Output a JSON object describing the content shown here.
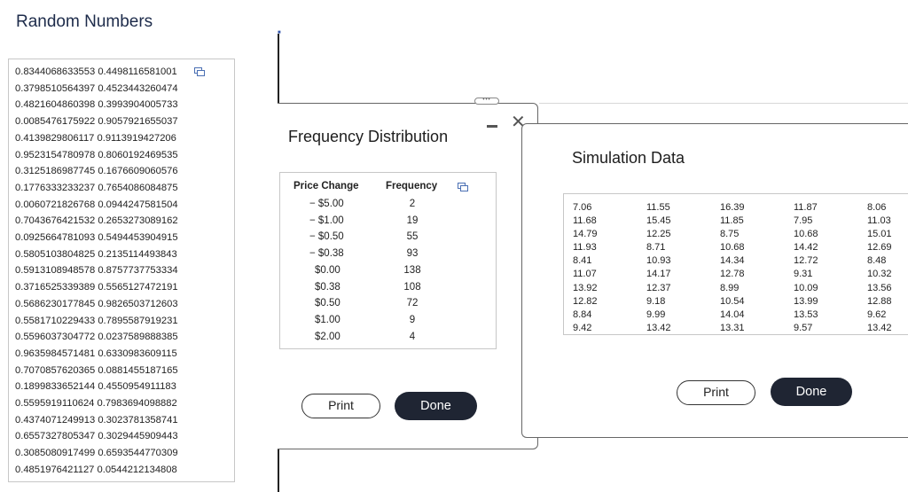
{
  "main_title": "Random Numbers",
  "random_numbers": [
    "0.8344068633553 0.4498116581001",
    "0.3798510564397 0.4523443260474",
    "0.4821604860398 0.3993904005733",
    "0.0085476175922 0.9057921655037",
    "0.4139829806117 0.9113919427206",
    "0.9523154780978 0.8060192469535",
    "0.3125186987745 0.1676609060576",
    "0.1776333233237 0.7654086084875",
    "0.0060721826768 0.0944247581504",
    "0.7043676421532 0.2653273089162",
    "0.0925664781093 0.5494453904915",
    "0.5805103804825 0.2135114493843",
    "0.5913108948578 0.8757737753334",
    "0.3716525339389 0.5565127472191",
    "0.5686230177845 0.9826503712603",
    "0.5581710229433 0.7895587919231",
    "0.5596037304772 0.0237589888385",
    "0.9635984571481 0.6330983609115",
    "0.7070857620365 0.0881455187165",
    "0.1899833652144 0.4550954911183",
    "0.5595919110624 0.7983694098882",
    "0.4374071249913 0.3023781358741",
    "0.6557327805347 0.3029445909443",
    "0.3085080917499 0.6593544770309",
    "0.4851976421127 0.0544212134808"
  ],
  "freq_window": {
    "title": "Frequency Distribution",
    "headers": {
      "price_change": "Price Change",
      "frequency": "Frequency"
    },
    "rows": [
      {
        "price": "− $5.00",
        "freq": "2"
      },
      {
        "price": "− $1.00",
        "freq": "19"
      },
      {
        "price": "− $0.50",
        "freq": "55"
      },
      {
        "price": "− $0.38",
        "freq": "93"
      },
      {
        "price": "$0.00",
        "freq": "138"
      },
      {
        "price": "$0.38",
        "freq": "108"
      },
      {
        "price": "$0.50",
        "freq": "72"
      },
      {
        "price": "$1.00",
        "freq": "9"
      },
      {
        "price": "$2.00",
        "freq": "4"
      }
    ],
    "print_label": "Print",
    "done_label": "Done"
  },
  "sim_window": {
    "title": "Simulation Data",
    "columns": [
      [
        "7.06",
        "11.68",
        "14.79",
        "11.93",
        "8.41",
        "11.07",
        "13.92",
        "12.82",
        "8.84",
        "9.42"
      ],
      [
        "11.55",
        "15.45",
        "12.25",
        "8.71",
        "10.93",
        "14.17",
        "12.37",
        "9.18",
        "9.99",
        "13.42"
      ],
      [
        "16.39",
        "11.85",
        "8.75",
        "10.68",
        "14.34",
        "12.78",
        "8.99",
        "10.54",
        "14.04",
        "13.31"
      ],
      [
        "11.87",
        "7.95",
        "10.68",
        "14.42",
        "12.72",
        "9.31",
        "10.09",
        "13.99",
        "13.53",
        "9.57"
      ],
      [
        "8.06",
        "11.03",
        "15.01",
        "12.69",
        "8.48",
        "10.32",
        "13.56",
        "12.88",
        "9.62",
        "13.42"
      ]
    ],
    "print_label": "Print",
    "done_label": "Done"
  },
  "icons": {
    "copy": "copy-icon",
    "close": "close-icon",
    "minimize": "minimize-icon"
  }
}
